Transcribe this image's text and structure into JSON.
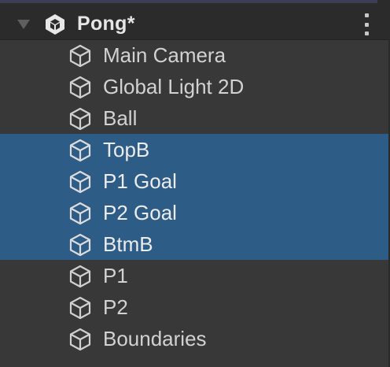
{
  "scene": {
    "title": "Pong*",
    "icon": "unity-scene-icon",
    "expanded": true
  },
  "hierarchy": {
    "items": [
      {
        "label": "Main Camera",
        "icon": "gameobject-cube-icon",
        "selected": false
      },
      {
        "label": "Global Light 2D",
        "icon": "gameobject-cube-icon",
        "selected": false
      },
      {
        "label": "Ball",
        "icon": "gameobject-cube-icon",
        "selected": false
      },
      {
        "label": "TopB",
        "icon": "gameobject-cube-icon",
        "selected": true
      },
      {
        "label": "P1 Goal",
        "icon": "gameobject-cube-icon",
        "selected": true
      },
      {
        "label": "P2 Goal",
        "icon": "gameobject-cube-icon",
        "selected": true
      },
      {
        "label": "BtmB",
        "icon": "gameobject-cube-icon",
        "selected": true
      },
      {
        "label": "P1",
        "icon": "gameobject-cube-icon",
        "selected": false
      },
      {
        "label": "P2",
        "icon": "gameobject-cube-icon",
        "selected": false
      },
      {
        "label": "Boundaries",
        "icon": "gameobject-cube-icon",
        "selected": false
      }
    ]
  },
  "colors": {
    "background": "#383838",
    "header": "#2b2b2b",
    "selection": "#2d5c87",
    "text": "#d2d2d2"
  }
}
